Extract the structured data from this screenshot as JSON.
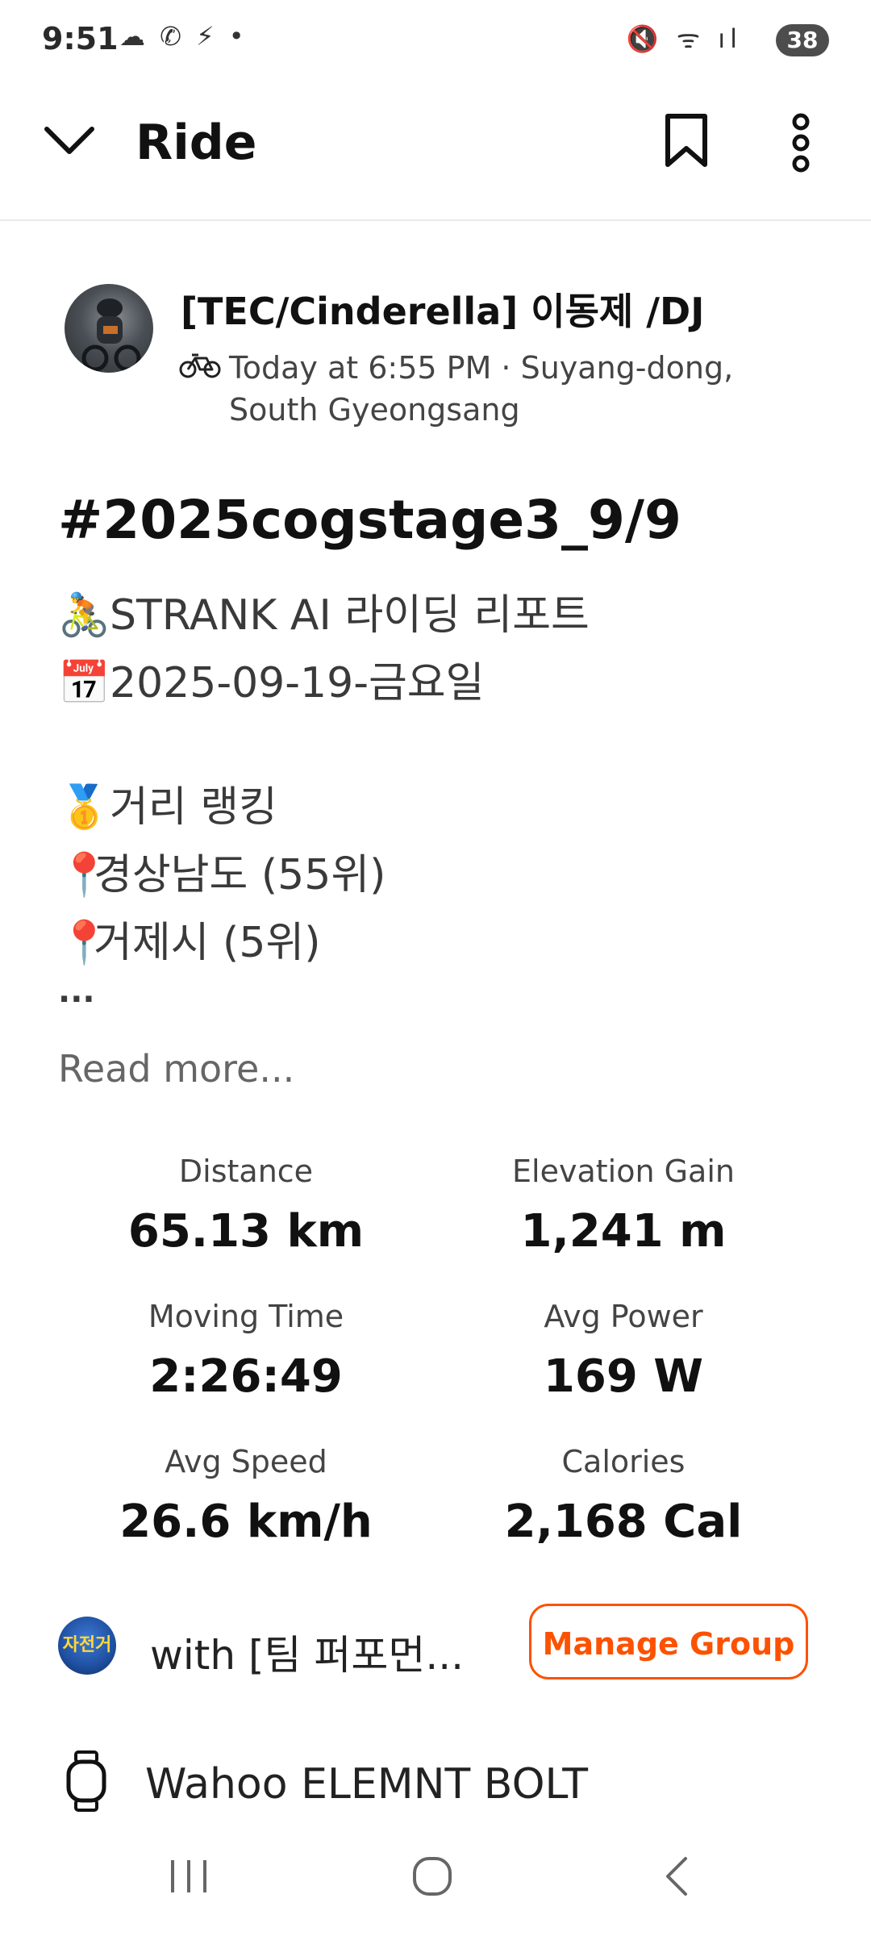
{
  "status": {
    "time": "9:51",
    "left_icons": "☁ ✆ ⚡ •",
    "right_icons": "🔇 ᯤ ıl",
    "battery": "38"
  },
  "header": {
    "title": "Ride"
  },
  "author": {
    "name": "[TEC/Cinderella] 이동제 /DJ",
    "meta_line1": "Today at 6:55 PM · Suyang-dong,",
    "meta_line2": "South Gyeongsang"
  },
  "activity": {
    "title": "#2025cogstage3_9/9",
    "desc_line1": "STRANK AI 라이딩 리포트",
    "desc_emoji1": "🚴",
    "desc_line2": "2025-09-19-금요일",
    "desc_emoji2": "📅",
    "desc_line3": "거리 랭킹",
    "desc_emoji3": "🥇",
    "desc_line4": "경상남도 (55위)",
    "desc_emoji4": "📍",
    "desc_line5": "거제시 (5위)",
    "desc_emoji5": "📍",
    "desc_ellipsis": "...",
    "read_more": "Read more..."
  },
  "stats": [
    {
      "label": "Distance",
      "value": "65.13 km"
    },
    {
      "label": "Elevation Gain",
      "value": "1,241 m"
    },
    {
      "label": "Moving Time",
      "value": "2:26:49"
    },
    {
      "label": "Avg Power",
      "value": "169 W"
    },
    {
      "label": "Avg Speed",
      "value": "26.6 km/h"
    },
    {
      "label": "Calories",
      "value": "2,168 Cal"
    }
  ],
  "group": {
    "text": "with [팀 퍼포먼...",
    "avatar_text": "자전거",
    "button": "Manage Group"
  },
  "device": {
    "name": "Wahoo ELEMNT BOLT"
  },
  "colors": {
    "accent": "#fc5200"
  }
}
